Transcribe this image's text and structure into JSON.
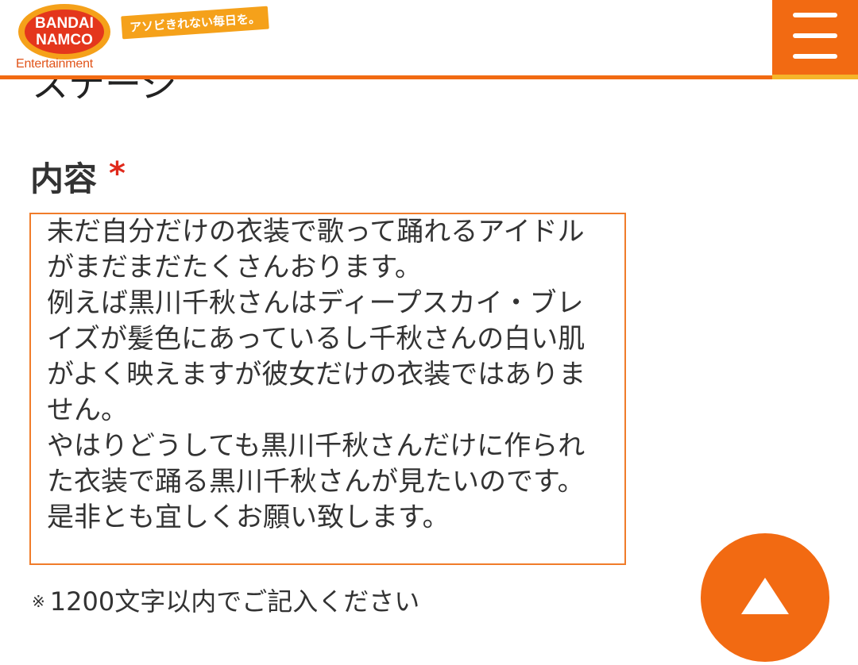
{
  "header": {
    "logo_line1": "BANDAI",
    "logo_line2": "NAMCO",
    "logo_sub": "Entertainment",
    "tagline": "アソビきれない毎日を。",
    "menu_icon": "hamburger-menu-icon"
  },
  "form": {
    "previous_field_partial": "ステージ",
    "content_label": "内容",
    "required_mark": "*",
    "content_value": "未だ自分だけの衣装で歌って踊れるアイドルがまだまだたくさんおります。\n例えば黒川千秋さんはディープスカイ・ブレイズが髪色にあっているし千秋さんの白い肌がよく映えますが彼女だけの衣装ではありません。\nやはりどうしても黒川千秋さんだけに作られた衣装で踊る黒川千秋さんが見たいのです。\n是非とも宜しくお願い致します。",
    "note_mark": "※",
    "note": "1200文字以内でご記入ください"
  },
  "scroll_top_icon": "triangle-up-icon",
  "colors": {
    "brand_orange": "#f26a12",
    "accent_yellow": "#f5b52a",
    "required_red": "#e0291b",
    "textarea_border": "#f07c2a"
  }
}
